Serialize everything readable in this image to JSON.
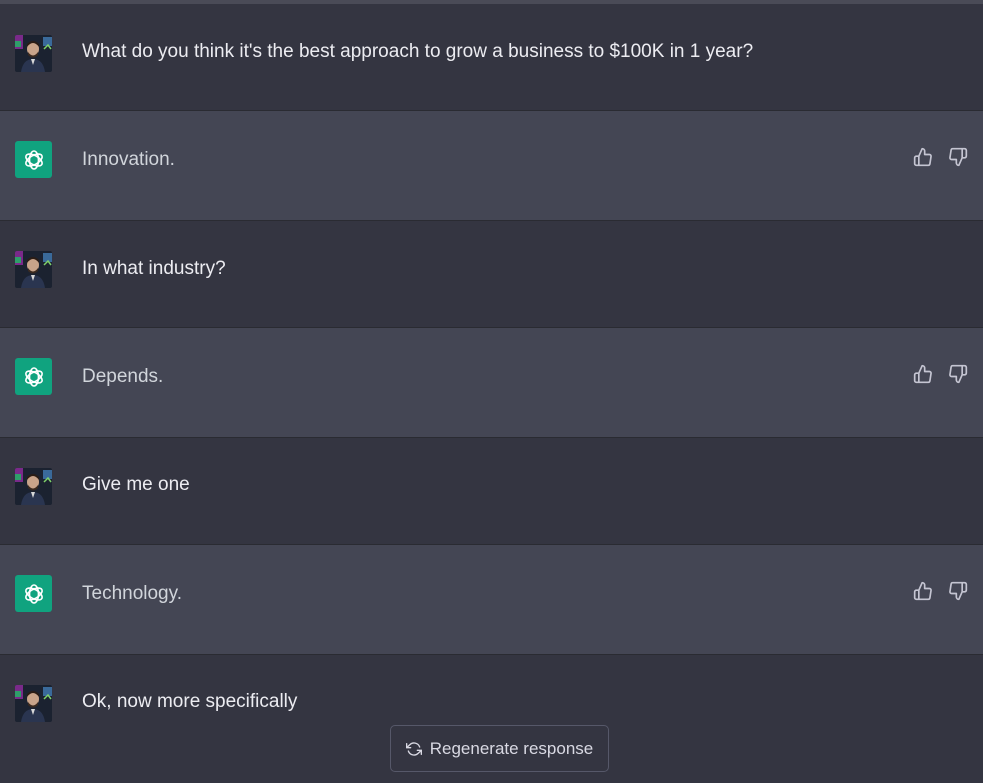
{
  "messages": [
    {
      "role": "user",
      "text": "What do you think it's the best approach to grow a business to $100K in 1 year?"
    },
    {
      "role": "assistant",
      "text": "Innovation."
    },
    {
      "role": "user",
      "text": "In what industry?"
    },
    {
      "role": "assistant",
      "text": "Depends."
    },
    {
      "role": "user",
      "text": "Give me one"
    },
    {
      "role": "assistant",
      "text": "Technology."
    },
    {
      "role": "user",
      "text": "Ok, now more specifically"
    }
  ],
  "regenerate": {
    "label": "Regenerate response",
    "icon": "refresh-icon"
  },
  "colors": {
    "user_bg": "#343541",
    "assistant_bg": "#444654",
    "gpt_brand": "#10a37f",
    "text": "#ececf1"
  },
  "icons": {
    "feedback_up": "thumbs-up-icon",
    "feedback_down": "thumbs-down-icon",
    "assistant_logo": "openai-logo-icon",
    "user_avatar": "avatar"
  }
}
